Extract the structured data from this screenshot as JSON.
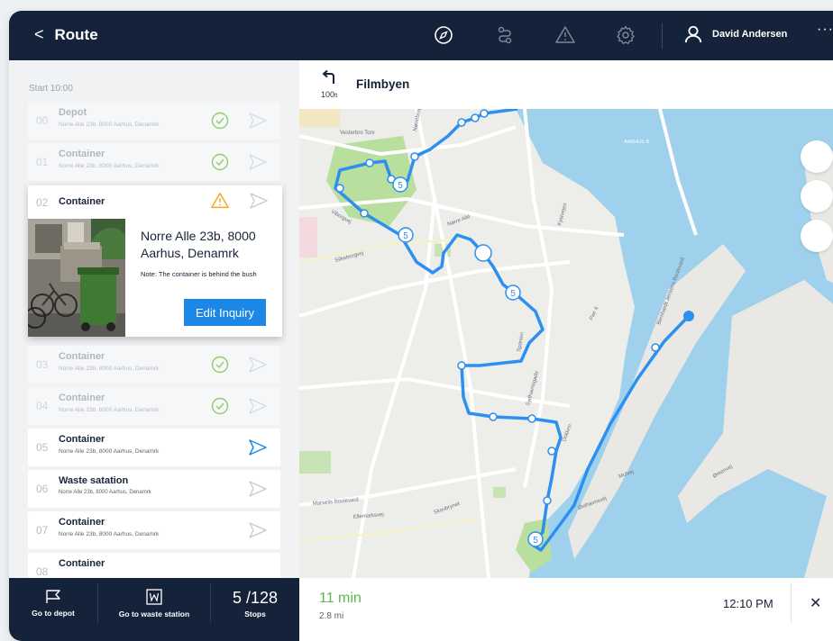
{
  "header": {
    "title": "Route",
    "user_name": "David Andersen"
  },
  "route": {
    "start_label": "Start 10:00",
    "stops": [
      {
        "num": "00",
        "title": "Depot",
        "address": "Norre Alle 23b, 8000 Aarhus, Denamrk",
        "status": "done"
      },
      {
        "num": "01",
        "title": "Container",
        "address": "Norre Alle 23b, 8000 Aarhus, Denamrk",
        "status": "done"
      },
      {
        "num": "02",
        "title": "Container",
        "status": "warning"
      },
      {
        "num": "03",
        "title": "Container",
        "address": "Norre Alle 23b, 8000 Aarhus, Denamrk",
        "status": "done"
      },
      {
        "num": "04",
        "title": "Container",
        "address": "Norre Alle 23b, 8000 Aarhus, Denamrk",
        "status": "done"
      },
      {
        "num": "05",
        "title": "Container",
        "address": "Norre Alle 23b, 8000 Aarhus, Denamrk",
        "status": "active"
      },
      {
        "num": "06",
        "title": "Waste satation",
        "address": "Norre Alle 23b, 8000 Aarhus, Denamrk",
        "status": "pending"
      },
      {
        "num": "07",
        "title": "Container",
        "address": "Norre Alle 23b, 8000 Aarhus, Denamrk",
        "status": "pending"
      },
      {
        "num": "08",
        "title": "Container",
        "status": "pending"
      }
    ],
    "expanded": {
      "address": "Norre Alle 23b, 8000 Aarhus, Denamrk",
      "note": "Note: The container is behind the bush",
      "edit_label": "Edit Inquiry"
    }
  },
  "bottom": {
    "depot_label": "Go to depot",
    "waste_label": "Go to waste station",
    "count": "5 /128",
    "count_label": "Stops"
  },
  "navigation": {
    "distance": "100",
    "distance_unit": "ft",
    "street": "Filmbyen"
  },
  "trip": {
    "eta": "11 min",
    "distance": "2.8 mi",
    "arrival": "12:10 PM",
    "close": "✕"
  },
  "map": {
    "labels": [
      "AARHUS B",
      "Vesterbro Torv",
      "Nørrebrogade",
      "Nørre Allé",
      "Silkeborgvej",
      "Viborgvej",
      "Spanien",
      "Sydhavnsgade",
      "Marselis Boulevard",
      "Ellemarksvej",
      "Skovbrynet",
      "Kystvejen",
      "Pier 4",
      "Dokken",
      "Mulvej",
      "Østhavnsvej",
      "Bernhardt Jensens Boulevard",
      "Ørkenvej"
    ],
    "route_badge": "5"
  },
  "colors": {
    "route": "#2d8ff0",
    "navy": "#14223a",
    "accent": "#1d87e6",
    "ok": "#8fcf6a",
    "warn": "#f5a623",
    "eta": "#5cb84a"
  }
}
